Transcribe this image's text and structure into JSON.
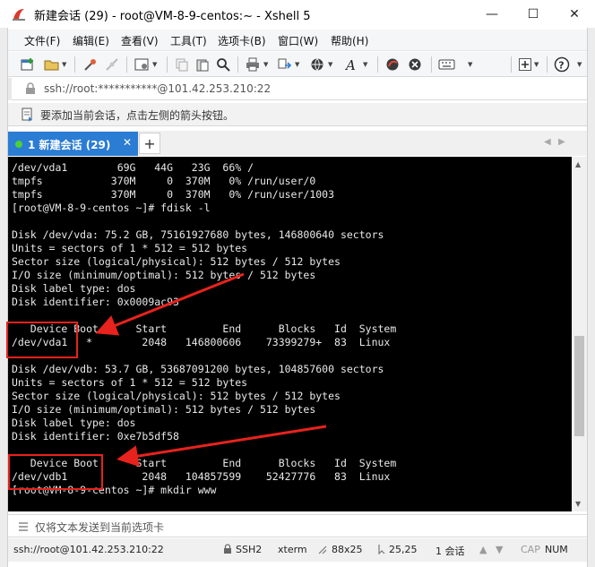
{
  "window": {
    "title": "新建会话 (29) - root@VM-8-9-centos:~ - Xshell 5",
    "minimize_glyph": "—",
    "maximize_glyph": "☐",
    "close_glyph": "✕"
  },
  "menu": {
    "items": [
      "文件(F)",
      "编辑(E)",
      "查看(V)",
      "工具(T)",
      "选项卡(B)",
      "窗口(W)",
      "帮助(H)"
    ]
  },
  "toolbar": {
    "icons": [
      "new-session-icon",
      "open-folder-icon",
      "connect-icon",
      "disconnect-icon",
      "properties-icon",
      "copy-icon",
      "paste-icon",
      "find-icon",
      "print-icon",
      "transfer-icon",
      "globe-icon",
      "font-icon",
      "xftp-icon",
      "xmanager-icon",
      "keyboard-icon",
      "new-tab-icon",
      "help-icon"
    ]
  },
  "address": {
    "text": "ssh://root:***********@101.42.253.210:22"
  },
  "hint": {
    "text": "要添加当前会话，点击左侧的箭头按钮。"
  },
  "tabs": {
    "active_label": "1 新建会话 (29)",
    "close_glyph": "✕",
    "add_glyph": "+",
    "prev_glyph": "◀",
    "next_glyph": "▶"
  },
  "terminal": {
    "lines": [
      "/dev/vda1        69G   44G   23G  66% /",
      "tmpfs           370M     0  370M   0% /run/user/0",
      "tmpfs           370M     0  370M   0% /run/user/1003",
      "[root@VM-8-9-centos ~]# fdisk -l",
      "",
      "Disk /dev/vda: 75.2 GB, 75161927680 bytes, 146800640 sectors",
      "Units = sectors of 1 * 512 = 512 bytes",
      "Sector size (logical/physical): 512 bytes / 512 bytes",
      "I/O size (minimum/optimal): 512 bytes / 512 bytes",
      "Disk label type: dos",
      "Disk identifier: 0x0009ac93",
      "",
      "   Device Boot      Start         End      Blocks   Id  System",
      "/dev/vda1   *        2048   146800606    73399279+  83  Linux",
      "",
      "Disk /dev/vdb: 53.7 GB, 53687091200 bytes, 104857600 sectors",
      "Units = sectors of 1 * 512 = 512 bytes",
      "Sector size (logical/physical): 512 bytes / 512 bytes",
      "I/O size (minimum/optimal): 512 bytes / 512 bytes",
      "Disk label type: dos",
      "Disk identifier: 0xe7b5df58",
      "",
      "   Device Boot      Start         End      Blocks   Id  System",
      "/dev/vdb1            2048   104857599    52427776   83  Linux",
      "[root@VM-8-9-centos ~]# mkdir www"
    ]
  },
  "sendbar": {
    "text": "仅将文本发送到当前选项卡"
  },
  "status": {
    "connection": "ssh://root@101.42.253.210:22",
    "protocol": "SSH2",
    "terminal_type": "xterm",
    "size": "88x25",
    "cursor": "25,25",
    "sessions": "1 会话",
    "caps": "CAP",
    "num": "NUM"
  },
  "colors": {
    "tab_active": "#2b7cd3",
    "annotation": "#e8221d",
    "terminal_bg": "#000000",
    "terminal_fg": "#e8e8e8"
  }
}
